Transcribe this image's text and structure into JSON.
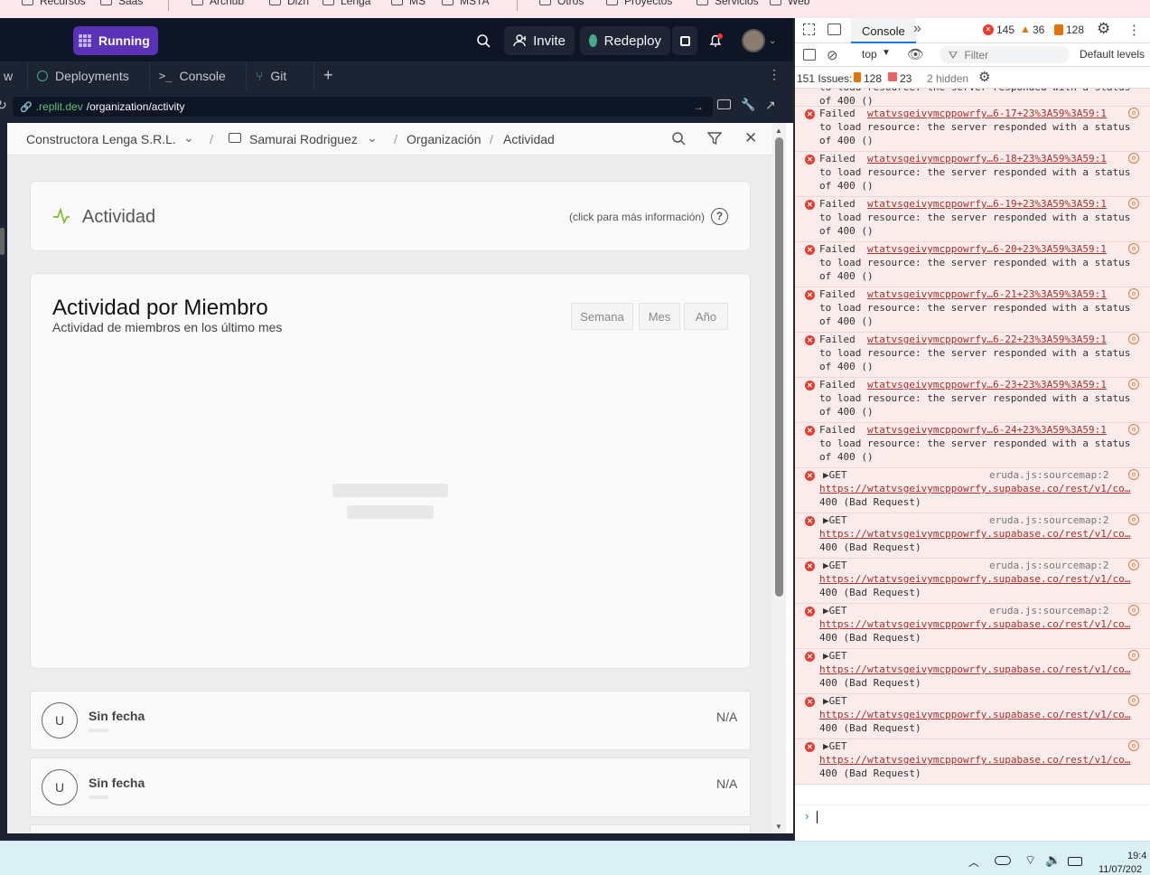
{
  "bookmarks": [
    "Recursos",
    "Saas",
    "Archub",
    "Dizn",
    "Lenga",
    "MS",
    "MSTA",
    "Otros",
    "Proyectos",
    "Servicios",
    "Web"
  ],
  "topbar": {
    "run_label": "Running",
    "invite_label": "Invite",
    "redeploy_label": "Redeploy"
  },
  "tabs": {
    "partial": "w",
    "deployments": "Deployments",
    "console": "Console",
    "git": "Git"
  },
  "url": {
    "domain": ".replit.dev",
    "path": "/organization/activity"
  },
  "header": {
    "org": "Constructora Lenga S.R.L.",
    "project": "Samurai Rodriguez",
    "sep": "/",
    "section": "Organización",
    "page": "Actividad"
  },
  "activity_card": {
    "title": "Actividad",
    "help": "(click para más información)"
  },
  "member_card": {
    "title": "Actividad por Miembro",
    "subtitle": "Actividad de miembros en los último mes",
    "periods": [
      "Semana",
      "Mes",
      "Año"
    ]
  },
  "rows": [
    {
      "avatar": "U",
      "date": "Sin fecha",
      "value": "N/A"
    },
    {
      "avatar": "U",
      "date": "Sin fecha",
      "value": "N/A"
    }
  ],
  "devtools": {
    "tab_console": "Console",
    "errors": "145",
    "warnings": "36",
    "infos": "128",
    "context": "top",
    "filter_placeholder": "Filter",
    "levels": "Default levels",
    "issues_label": "151 Issues:",
    "issues_a": "128",
    "issues_b": "23",
    "hidden": "2 hidden",
    "failed_rows": [
      {
        "link": "wtatvsgeivymcppowrfy…6-17+23%3A59%3A59:1"
      },
      {
        "link": "wtatvsgeivymcppowrfy…6-18+23%3A59%3A59:1"
      },
      {
        "link": "wtatvsgeivymcppowrfy…6-19+23%3A59%3A59:1"
      },
      {
        "link": "wtatvsgeivymcppowrfy…6-20+23%3A59%3A59:1"
      },
      {
        "link": "wtatvsgeivymcppowrfy…6-21+23%3A59%3A59:1"
      },
      {
        "link": "wtatvsgeivymcppowrfy…6-22+23%3A59%3A59:1"
      },
      {
        "link": "wtatvsgeivymcppowrfy…6-23+23%3A59%3A59:1"
      },
      {
        "link": "wtatvsgeivymcppowrfy…6-24+23%3A59%3A59:1"
      }
    ],
    "failed_word": "Failed",
    "failed_line2": "to load resource: the server responded with a status",
    "failed_line3": "of 400 ()",
    "get_rows": [
      {
        "source": "eruda.js:sourcemap:2"
      },
      {
        "source": "eruda.js:sourcemap:2"
      },
      {
        "source": "eruda.js:sourcemap:2"
      },
      {
        "source": "eruda.js:sourcemap:2"
      },
      {
        "source": ""
      },
      {
        "source": ""
      },
      {
        "source": ""
      }
    ],
    "get_word": "▶GET",
    "get_url": "https://wtatvsgeivymcppowrfy.supabase.co/rest/v1/co…",
    "get_status": "400 (Bad Request)"
  },
  "clock": {
    "time": "19:4",
    "date": "11/07/202"
  }
}
